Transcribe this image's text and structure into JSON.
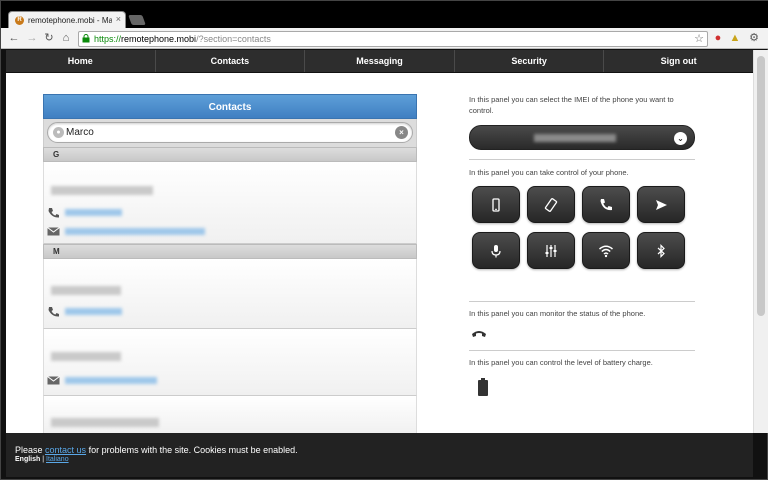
{
  "browser": {
    "tab_title": "remotephone.mobi - Marco",
    "tab_close": "×",
    "url_scheme": "https://",
    "url_host": "remotephone.mobi",
    "url_path": "/?section=contacts"
  },
  "nav": {
    "items": [
      "Home",
      "Contacts",
      "Messaging",
      "Security",
      "Sign out"
    ]
  },
  "contacts": {
    "header": "Contacts",
    "search_value": "Marco",
    "dividers": [
      "G",
      "M"
    ]
  },
  "panel": {
    "imei_text": "In this panel you can select the IMEI of the phone you want to control.",
    "control_text": "In this panel you can take control of your phone.",
    "status_text": "In this panel you can monitor the status of the phone.",
    "battery_text": "In this panel you can control the level of battery charge."
  },
  "controls": {
    "icons": [
      "phone-icon",
      "screen-rotate-icon",
      "call-icon",
      "send-icon",
      "microphone-icon",
      "equalizer-icon",
      "wifi-icon",
      "bluetooth-icon"
    ]
  },
  "footer": {
    "msg_before": "Please ",
    "contact_link": "contact us",
    "msg_after": " for problems with the site. Cookies must be enabled.",
    "lang_english": "English",
    "lang_sep": "|",
    "lang_italiano": "Italiano"
  },
  "colors": {
    "header_blue": "#3f7fc2",
    "link_blue": "#5aa8e8",
    "nav_dark": "#2d2d2d"
  }
}
